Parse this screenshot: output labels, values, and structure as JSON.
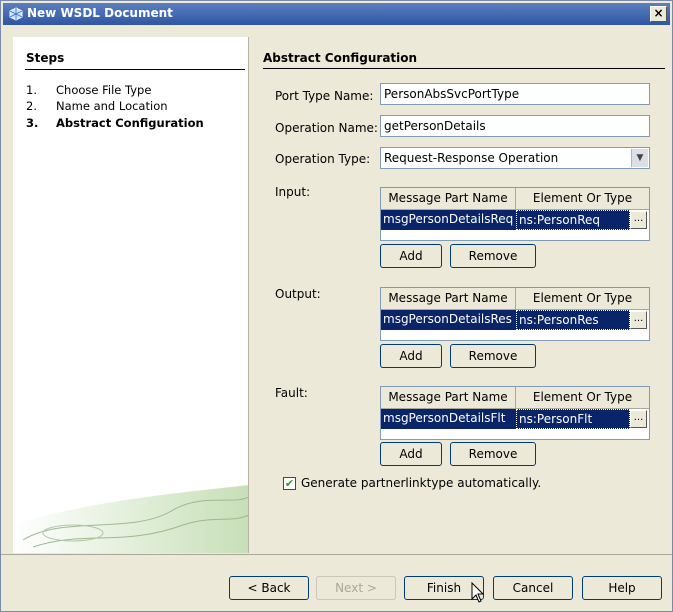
{
  "window": {
    "title": "New WSDL Document",
    "close_label": "×"
  },
  "steps": {
    "title": "Steps",
    "items": [
      {
        "num": "1.",
        "label": "Choose File Type"
      },
      {
        "num": "2.",
        "label": "Name and Location"
      },
      {
        "num": "3.",
        "label": "Abstract Configuration"
      }
    ]
  },
  "section": {
    "title": "Abstract Configuration"
  },
  "form": {
    "port_type_label": "Port Type Name:",
    "port_type_value": "PersonAbsSvcPortType",
    "operation_name_label": "Operation Name:",
    "operation_name_value": "getPersonDetails",
    "operation_type_label": "Operation Type:",
    "operation_type_value": "Request-Response Operation",
    "input_label": "Input:",
    "output_label": "Output:",
    "fault_label": "Fault:",
    "columns": [
      "Message Part Name",
      "Element Or Type"
    ],
    "input_row": {
      "part": "msgPersonDetailsReq",
      "type": "ns:PersonReq"
    },
    "output_row": {
      "part": "msgPersonDetailsRes",
      "type": "ns:PersonRes"
    },
    "fault_row": {
      "part": "msgPersonDetailsFlt",
      "type": "ns:PersonFlt"
    },
    "ellipsis": "...",
    "add_label": "Add",
    "remove_label": "Remove",
    "generate_label": "Generate partnerlinktype automatically.",
    "generate_checked": true
  },
  "footer": {
    "back_label": "< Back",
    "next_label": "Next >",
    "finish_label": "Finish",
    "cancel_label": "Cancel",
    "help_label": "Help"
  }
}
